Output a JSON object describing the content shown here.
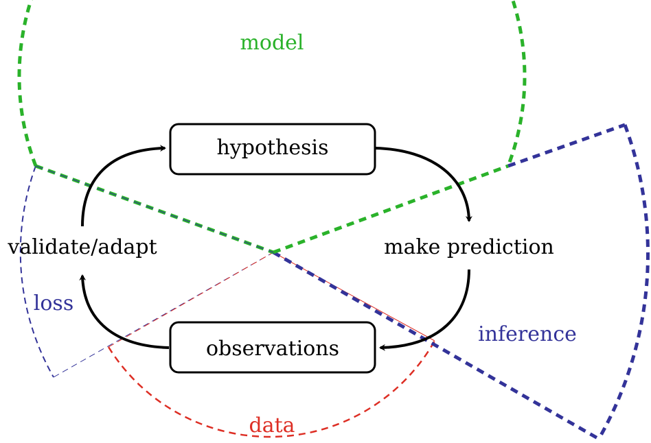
{
  "diagram": {
    "nodes": {
      "hypothesis": "hypothesis",
      "make_prediction": "make prediction",
      "observations": "observations",
      "validate_adapt": "validate/adapt"
    },
    "regions": {
      "model": "model",
      "inference": "inference",
      "data": "data",
      "loss": "loss"
    },
    "colors": {
      "model": "#2ab22a",
      "inference": "#333399",
      "data": "#dd2e24",
      "loss": "#333399",
      "ink": "#000000"
    },
    "flow": [
      "hypothesis",
      "make prediction",
      "observations",
      "validate/adapt"
    ]
  }
}
